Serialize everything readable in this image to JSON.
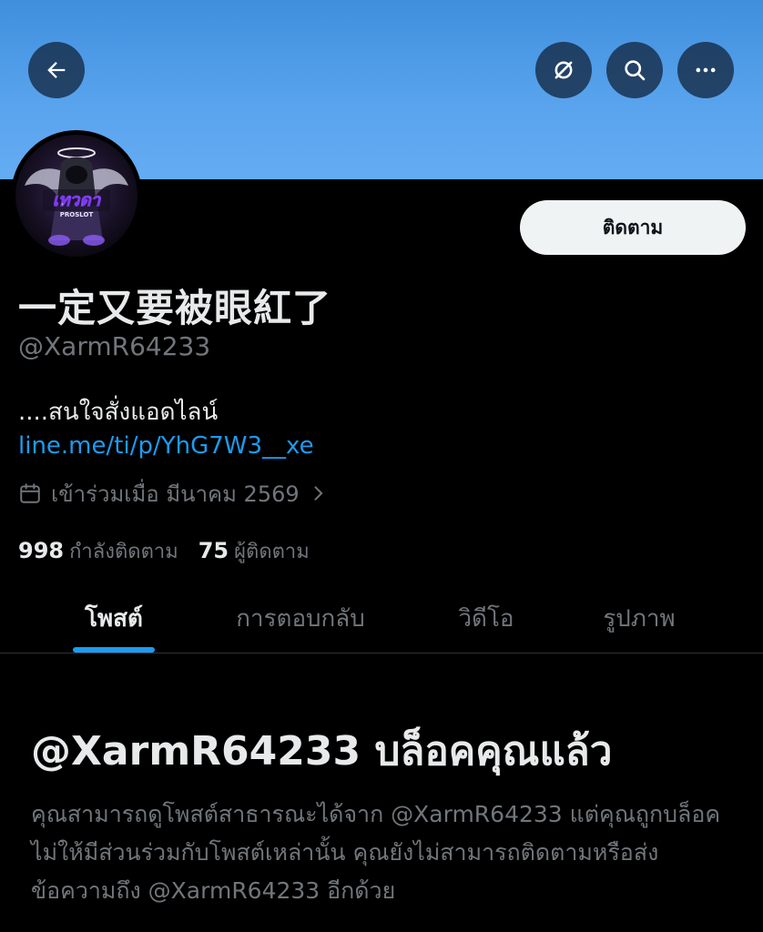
{
  "header": {
    "back_icon": "arrow-left-icon",
    "grok_icon": "grok-slash-icon",
    "search_icon": "search-icon",
    "more_icon": "more-dots-icon",
    "banner_color": "#5aa4ee"
  },
  "profile": {
    "avatar_text": "เทวดา",
    "avatar_subtext": "PROSLOT",
    "follow_label": "ติดตาม",
    "display_name": "一定又要被眼紅了",
    "handle": "@XarmR64233",
    "bio": "....สนใจสั่งแอดไลน์",
    "link": "line.me/ti/p/YhG7W3__xe",
    "joined": "เข้าร่วมเมื่อ มีนาคม 2569",
    "following_count": "998",
    "following_label": "กำลังติดตาม",
    "followers_count": "75",
    "followers_label": "ผู้ติดตาม"
  },
  "tabs": [
    {
      "label": "โพสต์",
      "active": true
    },
    {
      "label": "การตอบกลับ",
      "active": false
    },
    {
      "label": "วิดีโอ",
      "active": false
    },
    {
      "label": "รูปภาพ",
      "active": false
    }
  ],
  "blocked": {
    "title": "@XarmR64233 บล็อคคุณแล้ว",
    "body": "คุณสามารถดูโพสต์สาธารณะได้จาก @XarmR64233 แต่คุณถูกบล็อคไม่ให้มีส่วนร่วมกับโพสต์เหล่านั้น คุณยังไม่สามารถติดตามหรือส่งข้อความถึง @XarmR64233 อีกด้วย"
  },
  "colors": {
    "accent": "#1d9bf0",
    "muted": "#71767b",
    "text": "#e7e9ea",
    "background": "#000000"
  }
}
